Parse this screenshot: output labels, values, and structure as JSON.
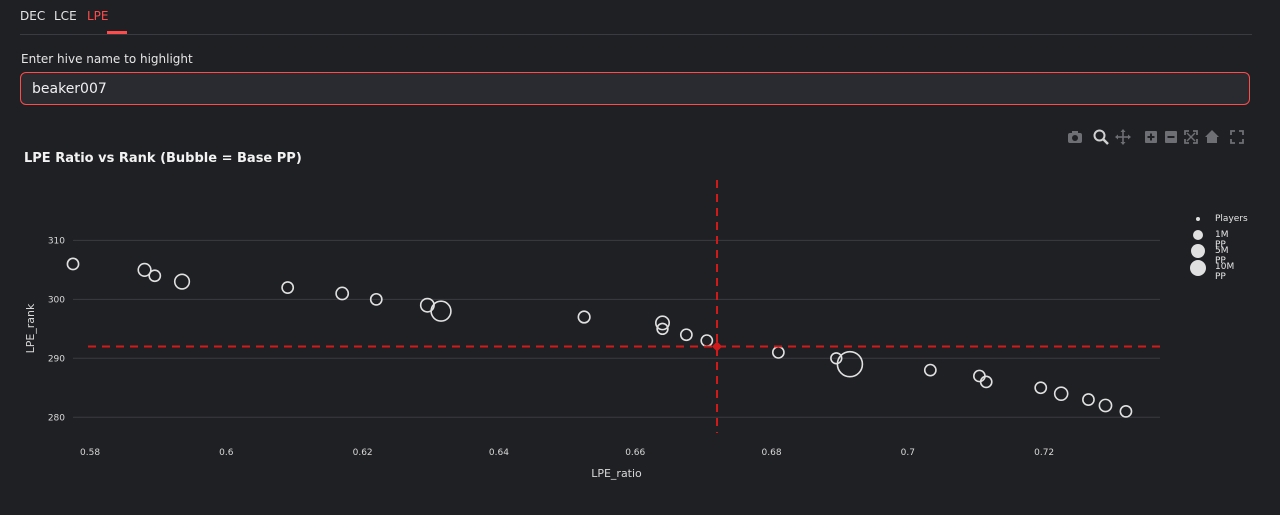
{
  "tabs": [
    {
      "label": "DEC",
      "active": false
    },
    {
      "label": "LCE",
      "active": false
    },
    {
      "label": "LPE",
      "active": true
    }
  ],
  "search": {
    "label": "Enter hive name to highlight",
    "value": "beaker007"
  },
  "toolbar": {
    "icons": [
      "camera-icon",
      "zoom-icon",
      "pan-icon",
      "zoom-in-icon",
      "zoom-out-icon",
      "autoscale-icon",
      "reset-axes-icon",
      "fullscreen-icon"
    ]
  },
  "colors": {
    "accent": "#ff4b4b",
    "highlight": "#d31a1a",
    "marker": "#e0e0e0",
    "background": "#1f2024",
    "grid": "#3a3b40"
  },
  "chart_data": {
    "type": "scatter",
    "title": "LPE Ratio vs Rank (Bubble = Base PP)",
    "xlabel": "LPE_ratio",
    "ylabel": "LPE_rank",
    "xlim": [
      0.5775,
      0.737
    ],
    "ylim": [
      277.5,
      316
    ],
    "xticks": [
      0.58,
      0.6,
      0.62,
      0.64,
      0.66,
      0.68,
      0.7,
      0.72
    ],
    "xtick_labels": [
      "0.58",
      "0.6",
      "0.62",
      "0.64",
      "0.66",
      "0.68",
      "0.7",
      "0.72"
    ],
    "yticks": [
      280,
      290,
      300,
      310
    ],
    "ytick_labels": [
      "280",
      "290",
      "300",
      "310"
    ],
    "grid": true,
    "legend_title": "Players",
    "legend": [
      {
        "label": "1M PP",
        "size": 1
      },
      {
        "label": "5M PP",
        "size": 5
      },
      {
        "label": "10M PP",
        "size": 10
      }
    ],
    "legend_position": "right",
    "highlight": {
      "x": 0.672,
      "y": 292
    },
    "points": [
      {
        "x": 0.5775,
        "y": 306,
        "pp": 0.7
      },
      {
        "x": 0.588,
        "y": 305,
        "pp": 1.2
      },
      {
        "x": 0.5895,
        "y": 304,
        "pp": 0.7
      },
      {
        "x": 0.5935,
        "y": 303,
        "pp": 2.0
      },
      {
        "x": 0.609,
        "y": 302,
        "pp": 0.7
      },
      {
        "x": 0.617,
        "y": 301,
        "pp": 1.0
      },
      {
        "x": 0.622,
        "y": 300,
        "pp": 0.7
      },
      {
        "x": 0.6295,
        "y": 299,
        "pp": 1.5
      },
      {
        "x": 0.6315,
        "y": 298,
        "pp": 5.5
      },
      {
        "x": 0.6525,
        "y": 297,
        "pp": 0.8
      },
      {
        "x": 0.664,
        "y": 296,
        "pp": 1.5
      },
      {
        "x": 0.664,
        "y": 295,
        "pp": 0.6
      },
      {
        "x": 0.6675,
        "y": 294,
        "pp": 0.7
      },
      {
        "x": 0.6705,
        "y": 293,
        "pp": 0.7
      },
      {
        "x": 0.681,
        "y": 291,
        "pp": 0.7
      },
      {
        "x": 0.6895,
        "y": 290,
        "pp": 0.6
      },
      {
        "x": 0.6915,
        "y": 289,
        "pp": 10.5
      },
      {
        "x": 0.7033,
        "y": 288,
        "pp": 0.7
      },
      {
        "x": 0.7105,
        "y": 287,
        "pp": 0.7
      },
      {
        "x": 0.7115,
        "y": 286,
        "pp": 0.7
      },
      {
        "x": 0.7195,
        "y": 285,
        "pp": 0.7
      },
      {
        "x": 0.7225,
        "y": 284,
        "pp": 1.3
      },
      {
        "x": 0.7265,
        "y": 283,
        "pp": 0.7
      },
      {
        "x": 0.729,
        "y": 282,
        "pp": 1.0
      },
      {
        "x": 0.732,
        "y": 281,
        "pp": 0.7
      }
    ]
  }
}
